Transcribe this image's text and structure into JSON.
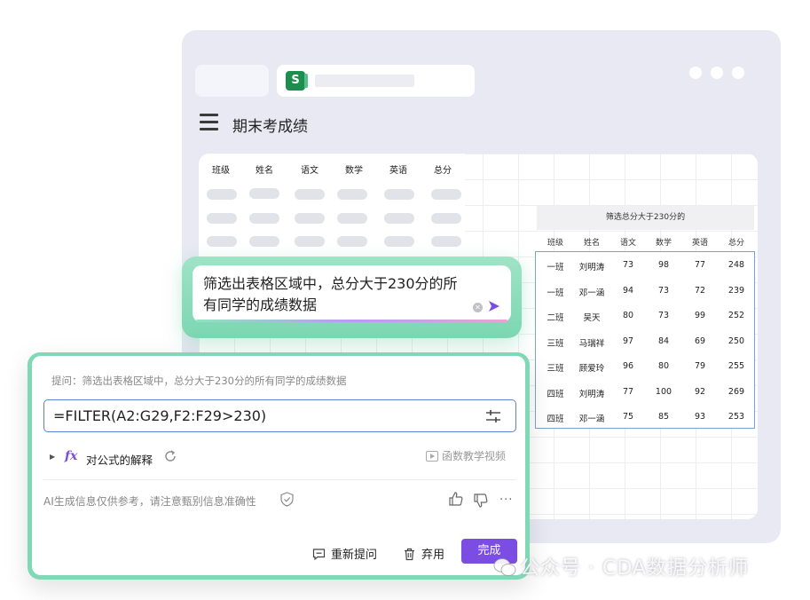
{
  "window": {
    "sheet_icon_letter": "S",
    "menu_icon": "hamburger-icon",
    "page_title": "期末考成绩"
  },
  "sheet": {
    "headers": [
      "班级",
      "姓名",
      "语文",
      "数学",
      "英语",
      "总分"
    ]
  },
  "result": {
    "title": "筛选总分大于230分的",
    "headers": [
      "班级",
      "姓名",
      "语文",
      "数学",
      "英语",
      "总分"
    ],
    "rows": [
      [
        "一班",
        "刘明涛",
        "73",
        "98",
        "77",
        "248"
      ],
      [
        "一班",
        "邓一涵",
        "94",
        "73",
        "72",
        "239"
      ],
      [
        "二班",
        "吴天",
        "80",
        "73",
        "99",
        "252"
      ],
      [
        "三班",
        "马瑞祥",
        "97",
        "84",
        "69",
        "250"
      ],
      [
        "三班",
        "顾爱玲",
        "96",
        "80",
        "79",
        "255"
      ],
      [
        "四班",
        "刘明涛",
        "77",
        "100",
        "92",
        "269"
      ],
      [
        "四班",
        "邓一涵",
        "75",
        "85",
        "93",
        "253"
      ]
    ]
  },
  "prompt": {
    "text": "筛选出表格区域中，总分大于230分的所有同学的成绩数据",
    "clear_icon": "clear-icon",
    "send_icon": "send-icon"
  },
  "panel": {
    "question": "提问：筛选出表格区域中，总分大于230分的所有同学的成绩数据",
    "formula": "=FILTER(A2:G29,F2:F29>230)",
    "fx_symbol": "fx",
    "explain_label": "对公式的解释",
    "video_link": "函数教学视频",
    "disclaimer": "AI生成信息仅供参考，请注意甄别信息准确性",
    "re_ask_label": "重新提问",
    "discard_label": "弃用",
    "done_label": "完成",
    "more_label": "···"
  },
  "watermark": {
    "text": "公众号 · CDA数据分析师"
  },
  "colors": {
    "accent_purple": "#7b4de3",
    "panel_green": "#7fd8b6",
    "formula_border": "#5d7fd6",
    "window_bg": "#e8e9f3",
    "sheets_green": "#1e8e4e"
  }
}
